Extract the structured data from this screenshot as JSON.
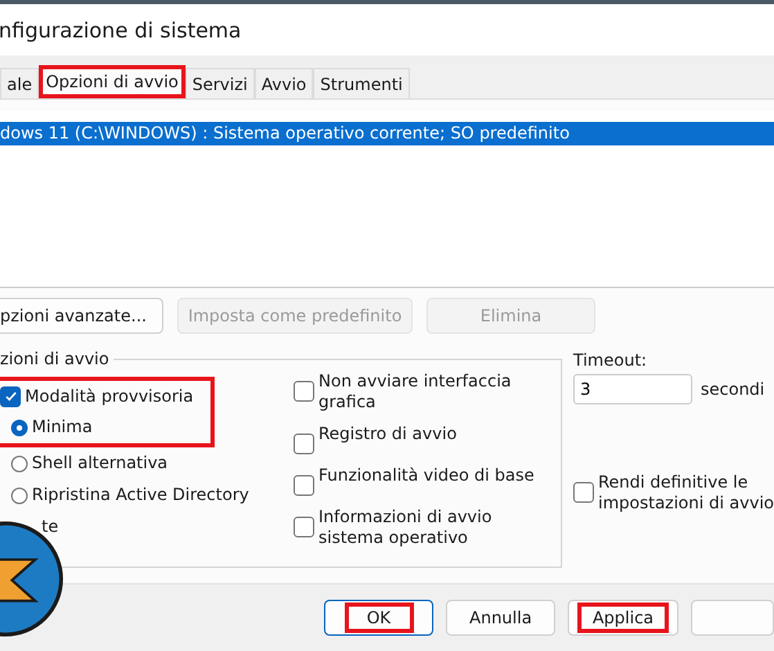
{
  "window": {
    "title": "nfigurazione di sistema"
  },
  "tabs": [
    {
      "label": "ale",
      "selected": false,
      "highlighted": false
    },
    {
      "label": "Opzioni di avvio",
      "selected": true,
      "highlighted": true
    },
    {
      "label": "Servizi",
      "selected": false,
      "highlighted": false
    },
    {
      "label": "Avvio",
      "selected": false,
      "highlighted": false
    },
    {
      "label": "Strumenti",
      "selected": false,
      "highlighted": false
    }
  ],
  "os_list": [
    {
      "text": "dows 11 (C:\\WINDOWS) : Sistema operativo corrente; SO predefinito",
      "selected": true
    }
  ],
  "list_buttons": [
    {
      "label": "pzioni avanzate...",
      "disabled": false
    },
    {
      "label": "Imposta come predefinito",
      "disabled": true
    },
    {
      "label": "Elimina",
      "disabled": true
    }
  ],
  "boot_options": {
    "title": "zioni di avvio",
    "safe_mode": {
      "label": "Modalità provvisoria",
      "checked": true,
      "highlighted": true
    },
    "modes": [
      {
        "label": "Minima",
        "selected": true
      },
      {
        "label": "Shell alternativa",
        "selected": false
      },
      {
        "label": "Ripristina Active Directory",
        "selected": false
      },
      {
        "label": "te"
      }
    ],
    "options": [
      {
        "label": "Non avviare interfaccia grafica",
        "checked": false
      },
      {
        "label": "Registro di avvio",
        "checked": false
      },
      {
        "label": "Funzionalità video di base",
        "checked": false
      },
      {
        "label": "Informazioni di avvio sistema operativo",
        "checked": false
      }
    ]
  },
  "timeout": {
    "label": "Timeout:",
    "value": "3",
    "unit": "secondi"
  },
  "make_permanent": {
    "label": "Rendi definitive le impostazioni di avvio",
    "checked": false
  },
  "buttons": [
    {
      "label": "OK",
      "default": true,
      "highlighted": true
    },
    {
      "label": "Annulla",
      "default": false,
      "highlighted": false
    },
    {
      "label": "Applica",
      "default": false,
      "highlighted": true
    },
    {
      "default": false,
      "highlighted": false
    }
  ]
}
